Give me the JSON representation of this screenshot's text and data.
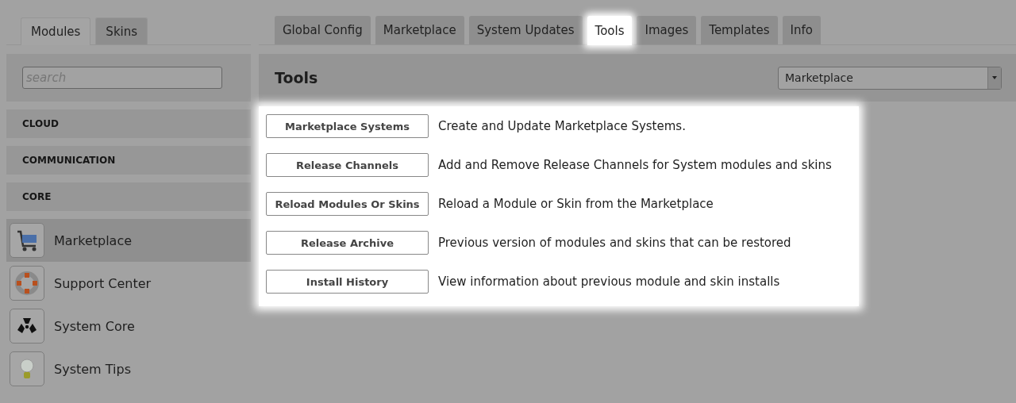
{
  "sidebar": {
    "tabs": [
      {
        "label": "Modules",
        "selected": true
      },
      {
        "label": "Skins",
        "selected": false
      }
    ],
    "search": {
      "placeholder": "search"
    },
    "categories": [
      "CLOUD",
      "COMMUNICATION",
      "CORE"
    ],
    "items": [
      {
        "label": "Marketplace",
        "selected": true
      },
      {
        "label": "Support Center",
        "selected": false
      },
      {
        "label": "System Core",
        "selected": false
      },
      {
        "label": "System Tips",
        "selected": false
      }
    ]
  },
  "tabs": [
    {
      "label": "Global Config",
      "selected": false
    },
    {
      "label": "Marketplace",
      "selected": false
    },
    {
      "label": "System Updates",
      "selected": false
    },
    {
      "label": "Tools",
      "selected": true
    },
    {
      "label": "Images",
      "selected": false
    },
    {
      "label": "Templates",
      "selected": false
    },
    {
      "label": "Info",
      "selected": false
    }
  ],
  "panel": {
    "title": "Tools",
    "dropdown": "Marketplace",
    "tools": [
      {
        "button": "Marketplace Systems",
        "description": "Create and Update Marketplace Systems."
      },
      {
        "button": "Release Channels",
        "description": "Add and Remove Release Channels for System modules and skins"
      },
      {
        "button": "Reload Modules Or Skins",
        "description": "Reload a Module or Skin from the Marketplace"
      },
      {
        "button": "Release Archive",
        "description": "Previous version of modules and skins that can be restored"
      },
      {
        "button": "Install History",
        "description": "View information about previous module and skin installs"
      }
    ]
  }
}
